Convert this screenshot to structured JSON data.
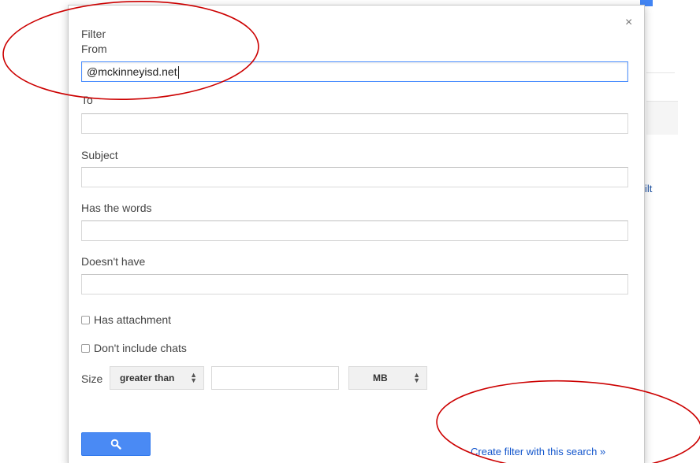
{
  "background": {
    "partial_text": "ilt",
    "accent_color": "#4285f4"
  },
  "dialog": {
    "title": "Filter",
    "close_icon": "close-icon",
    "close_glyph": "×",
    "fields": {
      "from_label": "From",
      "from_value": "@mckinneyisd.net",
      "to_label": "To",
      "to_value": "",
      "subject_label": "Subject",
      "subject_value": "",
      "has_words_label": "Has the words",
      "has_words_value": "",
      "doesnt_have_label": "Doesn't have",
      "doesnt_have_value": ""
    },
    "checkboxes": {
      "has_attachment_label": "Has attachment",
      "has_attachment_checked": false,
      "dont_include_chats_label": "Don't include chats",
      "dont_include_chats_checked": false
    },
    "size": {
      "label": "Size",
      "comparison_selected": "greater than",
      "value": "",
      "unit_selected": "MB"
    },
    "search_button_icon": "search-icon",
    "search_button_color": "#4a8af4",
    "create_filter_link": "Create filter with this search »"
  },
  "annotations": {
    "color": "#cc0000",
    "highlighted": [
      "from-field",
      "create-filter-link"
    ]
  }
}
